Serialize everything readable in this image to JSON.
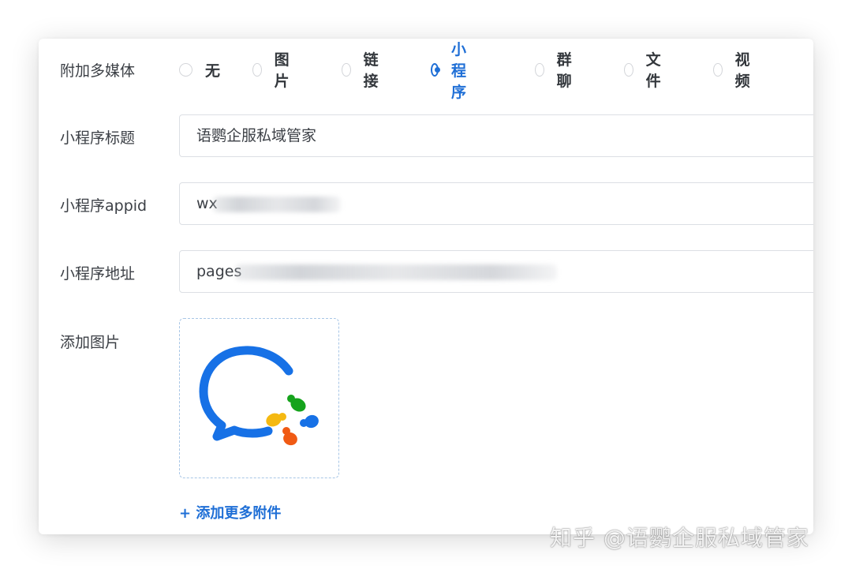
{
  "form": {
    "media": {
      "label": "附加多媒体",
      "options": [
        "无",
        "图片",
        "链接",
        "小程序",
        "群聊",
        "文件",
        "视频"
      ],
      "selected": "小程序"
    },
    "title": {
      "label": "小程序标题",
      "value": "语鹦企服私域管家"
    },
    "appid": {
      "label": "小程序appid",
      "value": "wx"
    },
    "path": {
      "label": "小程序地址",
      "value": "pages"
    },
    "image": {
      "label": "添加图片",
      "logo": "wecom-logo-icon"
    },
    "add_more": "+ 添加更多附件"
  },
  "watermark": "知乎 @语鹦企服私域管家",
  "colors": {
    "accent": "#1f6fd6",
    "text": "#3b3f45",
    "border": "#dcdfe4"
  }
}
